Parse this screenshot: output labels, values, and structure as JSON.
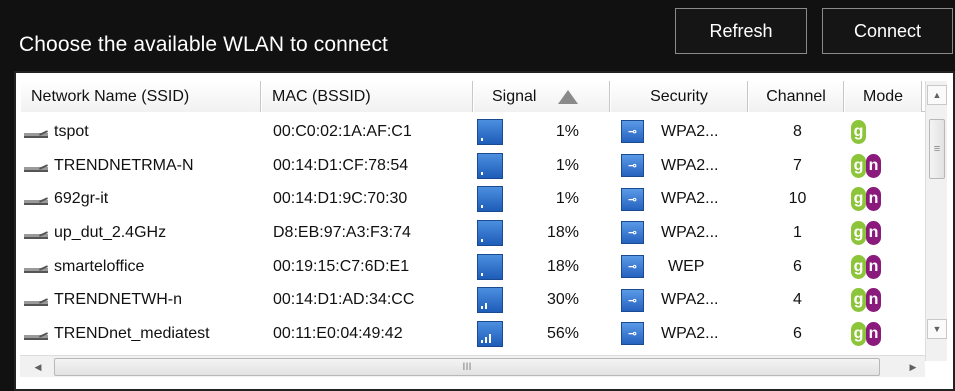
{
  "header": {
    "title": "Choose the available WLAN to connect",
    "refresh_label": "Refresh",
    "connect_label": "Connect"
  },
  "table": {
    "columns": [
      "Network Name (SSID)",
      "MAC (BSSID)",
      "Signal",
      "Security",
      "Channel",
      "Mode"
    ],
    "sort_column": "Signal",
    "rows": [
      {
        "ssid": "tspot",
        "mac": "00:C0:02:1A:AF:C1",
        "signal": "1%",
        "security": "WPA2...",
        "channel": "8",
        "mode": [
          "g"
        ]
      },
      {
        "ssid": "TRENDNETRMA-N",
        "mac": "00:14:D1:CF:78:54",
        "signal": "1%",
        "security": "WPA2...",
        "channel": "7",
        "mode": [
          "g",
          "n"
        ]
      },
      {
        "ssid": "692gr-it",
        "mac": "00:14:D1:9C:70:30",
        "signal": "1%",
        "security": "WPA2...",
        "channel": "10",
        "mode": [
          "g",
          "n"
        ]
      },
      {
        "ssid": "up_dut_2.4GHz",
        "mac": "D8:EB:97:A3:F3:74",
        "signal": "18%",
        "security": "WPA2...",
        "channel": "1",
        "mode": [
          "g",
          "n"
        ]
      },
      {
        "ssid": "smarteloffice",
        "mac": "00:19:15:C7:6D:E1",
        "signal": "18%",
        "security": "WEP",
        "channel": "6",
        "mode": [
          "g",
          "n"
        ]
      },
      {
        "ssid": "TRENDNETWH-n",
        "mac": "00:14:D1:AD:34:CC",
        "signal": "30%",
        "security": "WPA2...",
        "channel": "4",
        "mode": [
          "g",
          "n"
        ]
      },
      {
        "ssid": "TRENDnet_mediatest",
        "mac": "00:11:E0:04:49:42",
        "signal": "56%",
        "security": "WPA2...",
        "channel": "6",
        "mode": [
          "g",
          "n"
        ]
      }
    ]
  },
  "icons": {
    "router": "router-icon",
    "signal": "signal-strength-icon",
    "lock": "lock-icon",
    "sort": "sort-ascending-icon"
  },
  "colors": {
    "mode_g": "#8cc43a",
    "mode_n": "#8a1a7c",
    "signal_blue": "#2a6cc8"
  },
  "hscroll_grip": "III"
}
